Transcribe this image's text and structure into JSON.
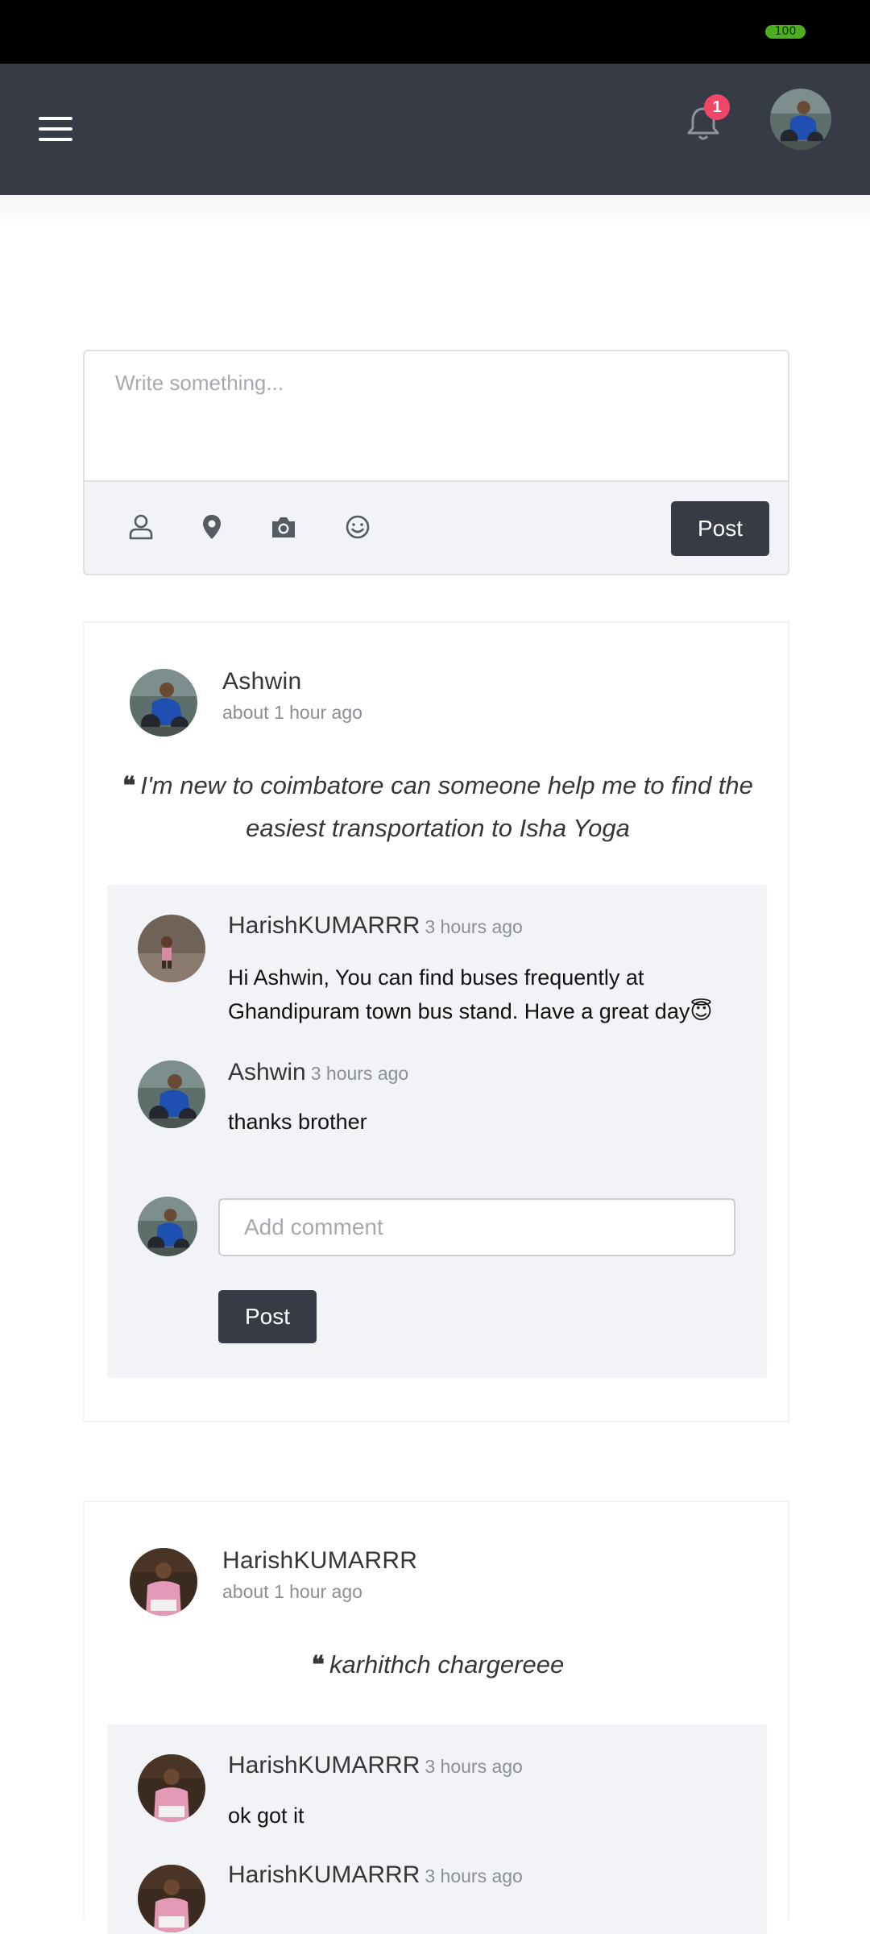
{
  "status_bar": {
    "battery": "100"
  },
  "navbar": {
    "notification_count": "1"
  },
  "composer": {
    "placeholder": "Write something...",
    "tools": [
      "user-icon",
      "location-icon",
      "camera-icon",
      "smiley-icon"
    ],
    "post_label": "Post"
  },
  "posts": [
    {
      "author": "Ashwin",
      "time": "about 1 hour ago",
      "text": "I'm new to coimbatore can someone help me to find the easiest transportation to Isha Yoga",
      "comments": [
        {
          "author": "HarishKUMARRR",
          "time": "3 hours ago",
          "text": "Hi Ashwin, You can find buses frequently at Ghandipuram town bus stand. Have a great day😇"
        },
        {
          "author": "Ashwin",
          "time": "3 hours ago",
          "text": "thanks brother"
        }
      ],
      "add_comment_placeholder": "Add comment",
      "post_label": "Post"
    },
    {
      "author": "HarishKUMARRR",
      "time": "about 1 hour ago",
      "text": "karhithch chargereee",
      "comments": [
        {
          "author": "HarishKUMARRR",
          "time": "3 hours ago",
          "text": "ok got it"
        },
        {
          "author": "HarishKUMARRR",
          "time": "3 hours ago",
          "text": ""
        }
      ]
    }
  ],
  "colors": {
    "navbar": "#363b45",
    "badge": "#f14668",
    "panel": "#f1f3f6",
    "battery": "#4caf1f"
  }
}
